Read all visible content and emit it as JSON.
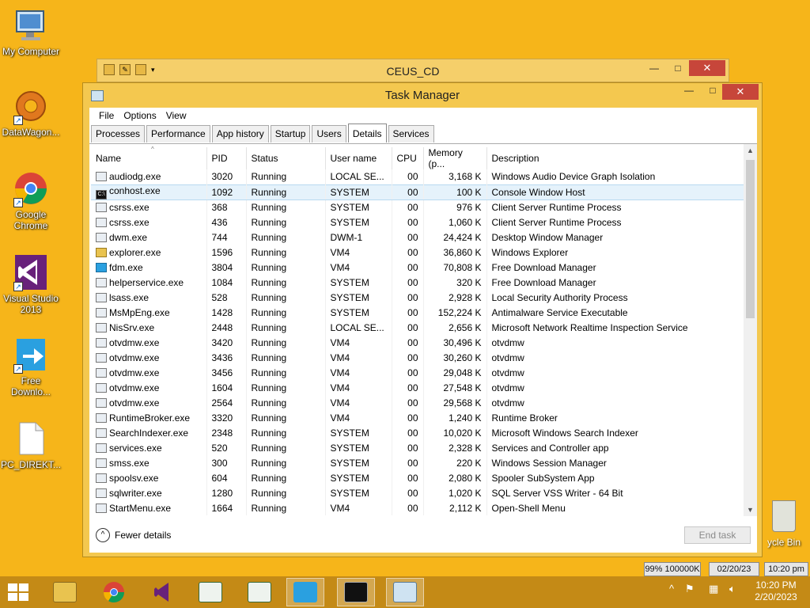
{
  "desktop": {
    "icons": [
      {
        "label": "My Computer"
      },
      {
        "label": "DataWagon..."
      },
      {
        "label": "Google Chrome"
      },
      {
        "label": "Visual Studio 2013"
      },
      {
        "label": "Free Downlo..."
      },
      {
        "label": "PC_DIREKT..."
      }
    ],
    "recycle_label": "ycle Bin"
  },
  "explorer": {
    "title": "CEUS_CD"
  },
  "taskmanager": {
    "title": "Task Manager",
    "menu": [
      "File",
      "Options",
      "View"
    ],
    "tabs": [
      "Processes",
      "Performance",
      "App history",
      "Startup",
      "Users",
      "Details",
      "Services"
    ],
    "active_tab": "Details",
    "columns": [
      "Name",
      "PID",
      "Status",
      "User name",
      "CPU",
      "Memory (p...",
      "Description"
    ],
    "rows": [
      [
        "audiodg.exe",
        "3020",
        "Running",
        "LOCAL SE...",
        "00",
        "3,168 K",
        "Windows Audio Device Graph Isolation"
      ],
      [
        "conhost.exe",
        "1092",
        "Running",
        "SYSTEM",
        "00",
        "100 K",
        "Console Window Host"
      ],
      [
        "csrss.exe",
        "368",
        "Running",
        "SYSTEM",
        "00",
        "976 K",
        "Client Server Runtime Process"
      ],
      [
        "csrss.exe",
        "436",
        "Running",
        "SYSTEM",
        "00",
        "1,060 K",
        "Client Server Runtime Process"
      ],
      [
        "dwm.exe",
        "744",
        "Running",
        "DWM-1",
        "00",
        "24,424 K",
        "Desktop Window Manager"
      ],
      [
        "explorer.exe",
        "1596",
        "Running",
        "VM4",
        "00",
        "36,860 K",
        "Windows Explorer"
      ],
      [
        "fdm.exe",
        "3804",
        "Running",
        "VM4",
        "00",
        "70,808 K",
        "Free Download Manager"
      ],
      [
        "helperservice.exe",
        "1084",
        "Running",
        "SYSTEM",
        "00",
        "320 K",
        "Free Download Manager"
      ],
      [
        "lsass.exe",
        "528",
        "Running",
        "SYSTEM",
        "00",
        "2,928 K",
        "Local Security Authority Process"
      ],
      [
        "MsMpEng.exe",
        "1428",
        "Running",
        "SYSTEM",
        "00",
        "152,224 K",
        "Antimalware Service Executable"
      ],
      [
        "NisSrv.exe",
        "2448",
        "Running",
        "LOCAL SE...",
        "00",
        "2,656 K",
        "Microsoft Network Realtime Inspection Service"
      ],
      [
        "otvdmw.exe",
        "3420",
        "Running",
        "VM4",
        "00",
        "30,496 K",
        "otvdmw"
      ],
      [
        "otvdmw.exe",
        "3436",
        "Running",
        "VM4",
        "00",
        "30,260 K",
        "otvdmw"
      ],
      [
        "otvdmw.exe",
        "3456",
        "Running",
        "VM4",
        "00",
        "29,048 K",
        "otvdmw"
      ],
      [
        "otvdmw.exe",
        "1604",
        "Running",
        "VM4",
        "00",
        "27,548 K",
        "otvdmw"
      ],
      [
        "otvdmw.exe",
        "2564",
        "Running",
        "VM4",
        "00",
        "29,568 K",
        "otvdmw"
      ],
      [
        "RuntimeBroker.exe",
        "3320",
        "Running",
        "VM4",
        "00",
        "1,240 K",
        "Runtime Broker"
      ],
      [
        "SearchIndexer.exe",
        "2348",
        "Running",
        "SYSTEM",
        "00",
        "10,020 K",
        "Microsoft Windows Search Indexer"
      ],
      [
        "services.exe",
        "520",
        "Running",
        "SYSTEM",
        "00",
        "2,328 K",
        "Services and Controller app"
      ],
      [
        "smss.exe",
        "300",
        "Running",
        "SYSTEM",
        "00",
        "220 K",
        "Windows Session Manager"
      ],
      [
        "spoolsv.exe",
        "604",
        "Running",
        "SYSTEM",
        "00",
        "2,080 K",
        "Spooler SubSystem App"
      ],
      [
        "sqlwriter.exe",
        "1280",
        "Running",
        "SYSTEM",
        "00",
        "1,020 K",
        "SQL Server VSS Writer - 64 Bit"
      ],
      [
        "StartMenu.exe",
        "1664",
        "Running",
        "VM4",
        "00",
        "2,112 K",
        "Open-Shell Menu"
      ]
    ],
    "selected_row_index": 1,
    "fewer_details": "Fewer details",
    "end_task": "End task"
  },
  "status": {
    "memory": "99% 100000K",
    "date": "02/20/23",
    "time": "10:20 pm"
  },
  "taskbar": {
    "clock_time": "10:20 PM",
    "clock_date": "2/20/2023"
  },
  "colors": {
    "desktop": "#f6b51a",
    "window_frame": "#f4c84f",
    "taskbar": "#c48a16",
    "close": "#c7463a",
    "selection": "#e5f2fb"
  }
}
